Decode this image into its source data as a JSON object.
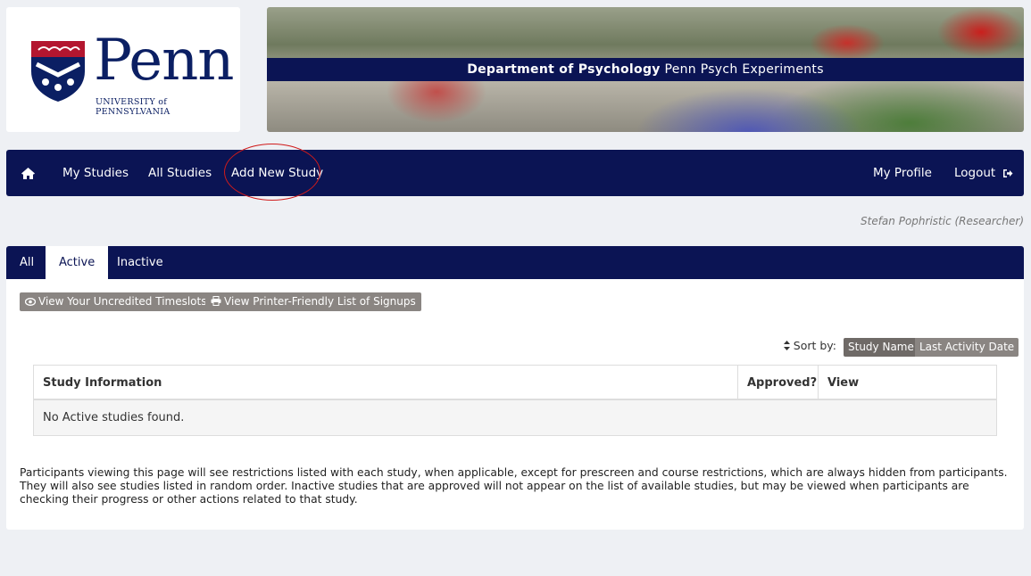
{
  "header": {
    "logo_word": "Penn",
    "logo_sub": "UNIVERSITY of PENNSYLVANIA",
    "banner_bold": "Department of Psychology",
    "banner_rest": "Penn Psych Experiments"
  },
  "nav": {
    "home_icon": "home-icon",
    "left": [
      "My Studies",
      "All Studies",
      "Add New Study"
    ],
    "profile": "My Profile",
    "logout": "Logout",
    "logout_icon": "sign-out-icon"
  },
  "user": "Stefan Pophristic (Researcher)",
  "tabs": [
    "All",
    "Active",
    "Inactive"
  ],
  "active_tab": "Active",
  "buttons": {
    "uncredited": "View Your Uncredited Timeslots",
    "printer": "View Printer-Friendly List of Signups"
  },
  "sort": {
    "label": "Sort by:",
    "options": [
      "Study Name",
      "Last Activity Date"
    ]
  },
  "table": {
    "columns": [
      "Study Information",
      "Approved?",
      "View"
    ],
    "empty_message": "No Active studies found."
  },
  "note": "Participants viewing this page will see restrictions listed with each study, when applicable, except for prescreen and course restrictions, which are always hidden from participants. They will also see studies listed in random order.  Inactive studies that are approved will not appear on the list of available studies, but may be viewed when participants are checking their progress or other actions related to that study.",
  "colors": {
    "navy": "#0b1454",
    "gray_button": "#8a8582",
    "highlight": "#d01b1b"
  }
}
